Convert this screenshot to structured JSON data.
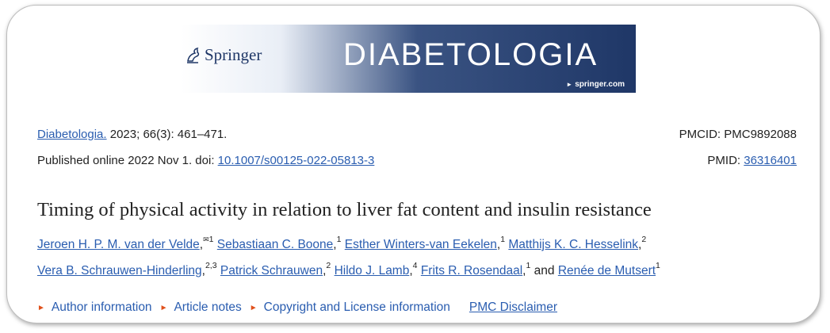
{
  "banner": {
    "publisher": "Springer",
    "journal_title": "DIABETOLOGIA",
    "site": "springer.com",
    "colors": {
      "navy": "#1f3767",
      "light": "#e9eef6"
    }
  },
  "citation": {
    "journal_link": "Diabetologia.",
    "volume_text": "2023; 66(3): 461–471.",
    "published_prefix": "Published online 2022 Nov 1. doi: ",
    "doi": "10.1007/s00125-022-05813-3",
    "pmcid": "PMCID: PMC9892088",
    "pmid_label": "PMID: ",
    "pmid": "36316401"
  },
  "article": {
    "title": "Timing of physical activity in relation to liver fat content and insulin resistance"
  },
  "authors": [
    {
      "name": "Jeroen H. P. M. van der Velde",
      "sup": "1",
      "mail": "✉"
    },
    {
      "name": "Sebastiaan C. Boone",
      "sup": "1"
    },
    {
      "name": "Esther Winters-van Eekelen",
      "sup": "1"
    },
    {
      "name": "Matthijs K. C. Hesselink",
      "sup": "2"
    },
    {
      "name": "Vera B. Schrauwen-Hinderling",
      "sup": "2,3"
    },
    {
      "name": "Patrick Schrauwen",
      "sup": "2"
    },
    {
      "name": "Hildo J. Lamb",
      "sup": "4"
    },
    {
      "name": "Frits R. Rosendaal",
      "sup": "1"
    },
    {
      "name": "Renée de Mutsert",
      "sup": "1"
    }
  ],
  "author_conjunction": "and",
  "links": {
    "author_info": "Author information",
    "article_notes": "Article notes",
    "copyright": "Copyright and License information",
    "disclaimer": "PMC Disclaimer",
    "accent": "#e0501b"
  }
}
